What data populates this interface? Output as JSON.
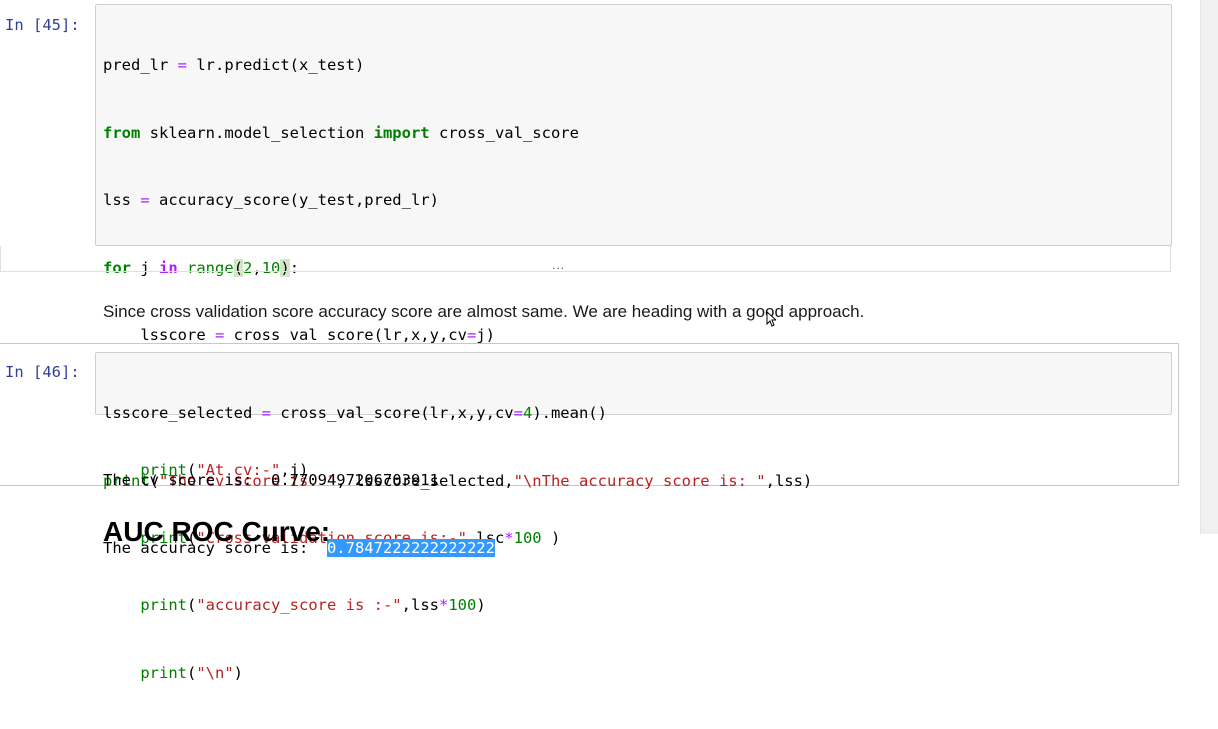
{
  "cells": {
    "cell45": {
      "prompt": "In [45]:",
      "ellipsis": "..."
    },
    "markdown": {
      "text": "Since cross validation score accuracy score are almost same. We are heading with a good approach."
    },
    "cell46": {
      "prompt": "In [46]:",
      "output_line1_label": "The cv score is:  ",
      "output_line1_value": "0.7709497206703911",
      "output_line2_label": "The accuracy score is:  ",
      "output_line2_value": "0.7847222222222222"
    },
    "next_heading": "AUC ROC Curve:"
  },
  "colors": {
    "prompt": "#303f9f",
    "keyword": "#008000",
    "string": "#ba2121",
    "operator": "#aa22ff",
    "selection": "#3399ff"
  }
}
